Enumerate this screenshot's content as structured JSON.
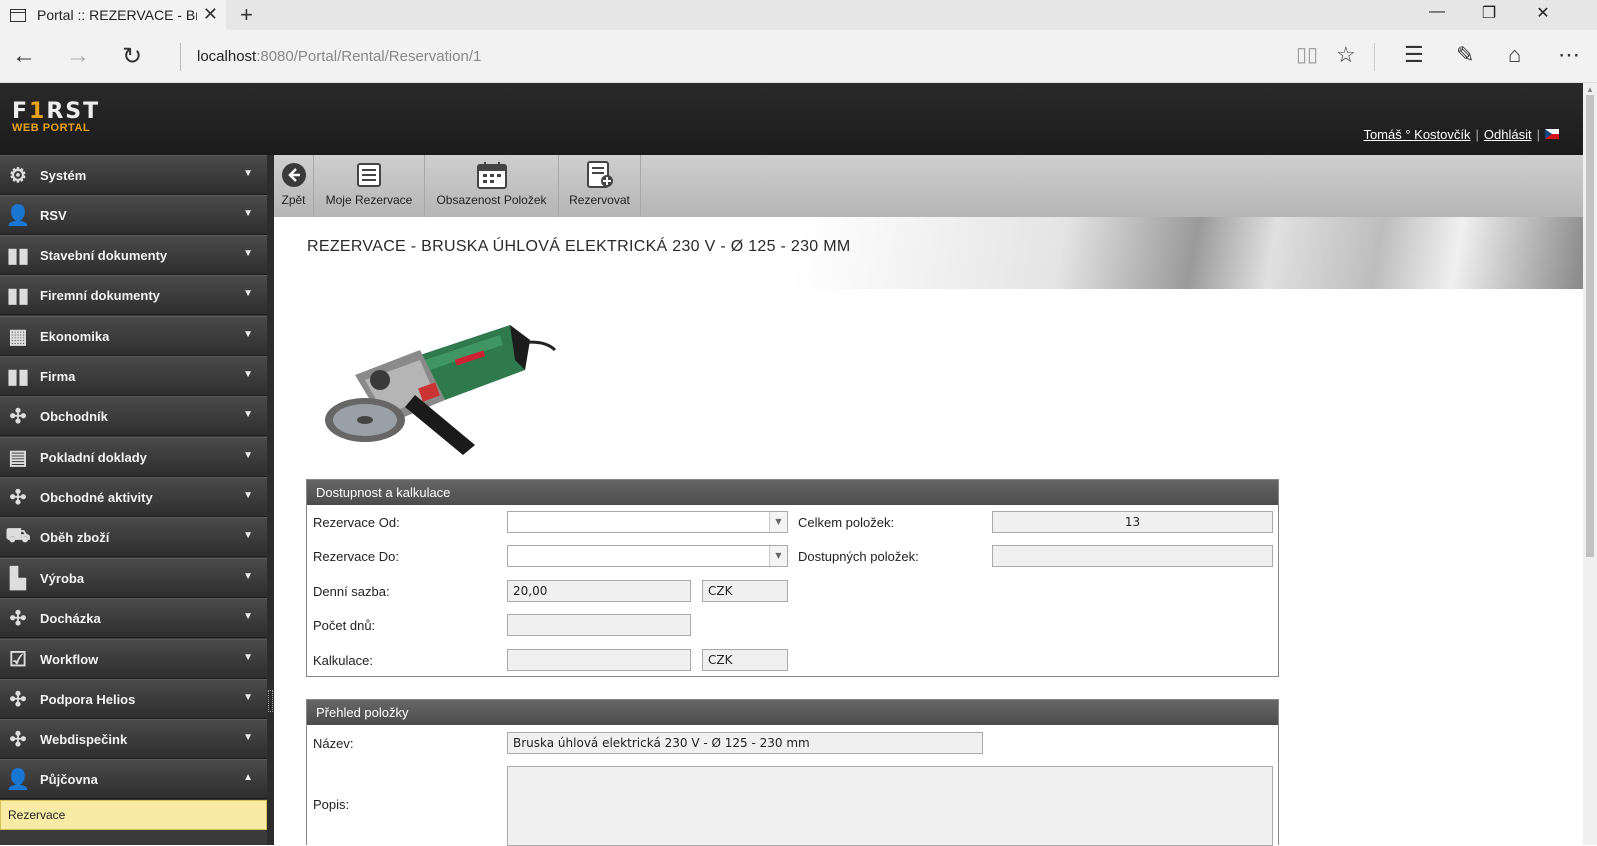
{
  "browser": {
    "tab_title": "Portal :: REZERVACE - Br",
    "url_host": "localhost",
    "url_path": ":8080/Portal/Rental/Reservation/1"
  },
  "header": {
    "logo_top_a": "F",
    "logo_top_b": "1",
    "logo_top_c": "RST",
    "logo_bottom": "WEB PORTAL",
    "user": "Tomáš ° Kostovčík",
    "logout": "Odhlásit"
  },
  "sidebar": {
    "items": [
      {
        "label": "Systém",
        "icon": "gear-icon"
      },
      {
        "label": "RSV",
        "icon": "person-icon"
      },
      {
        "label": "Stavební dokumenty",
        "icon": "binders-icon"
      },
      {
        "label": "Firemní dokumenty",
        "icon": "binders-icon"
      },
      {
        "label": "Ekonomika",
        "icon": "calculator-icon"
      },
      {
        "label": "Firma",
        "icon": "binders-icon"
      },
      {
        "label": "Obchodník",
        "icon": "arrows-icon"
      },
      {
        "label": "Pokladní doklady",
        "icon": "document-icon"
      },
      {
        "label": "Obchodné aktivity",
        "icon": "arrows-icon"
      },
      {
        "label": "Oběh zboží",
        "icon": "truck-icon"
      },
      {
        "label": "Výroba",
        "icon": "factory-icon"
      },
      {
        "label": "Docházka",
        "icon": "arrows-icon"
      },
      {
        "label": "Workflow",
        "icon": "calendar-check-icon"
      },
      {
        "label": "Podpora Helios",
        "icon": "arrows-icon"
      },
      {
        "label": "Webdispečink",
        "icon": "arrows-icon"
      },
      {
        "label": "Půjčovna",
        "icon": "person-icon"
      }
    ],
    "sub_item": "Rezervace"
  },
  "toolbar": {
    "back": "Zpět",
    "my_reservations": "Moje Rezervace",
    "occupancy": "Obsazenost Položek",
    "reserve": "Rezervovat"
  },
  "page": {
    "title": "REZERVACE - BRUSKA ÚHLOVÁ ELEKTRICKÁ 230 V - Ø 125 - 230 MM"
  },
  "availability": {
    "header": "Dostupnost a kalkulace",
    "from_label": "Rezervace Od:",
    "from_value": "",
    "to_label": "Rezervace Do:",
    "to_value": "",
    "daily_rate_label": "Denní sazba:",
    "daily_rate_value": "20,00",
    "currency": "CZK",
    "days_label": "Počet dnů:",
    "days_value": "",
    "calc_label": "Kalkulace:",
    "calc_value": "",
    "calc_currency": "CZK",
    "total_label": "Celkem položek:",
    "total_value": "13",
    "available_label": "Dostupných položek:",
    "available_value": ""
  },
  "overview": {
    "header": "Přehled položky",
    "name_label": "Název:",
    "name_value": "Bruska úhlová elektrická 230 V - Ø 125 - 230 mm",
    "desc_label": "Popis:",
    "desc_value": ""
  },
  "colors": {
    "accent": "#e8a21a",
    "header_bg": "#222222",
    "sidebar_bg": "#3a3a3a",
    "active_sub_bg": "#f7eba6"
  }
}
